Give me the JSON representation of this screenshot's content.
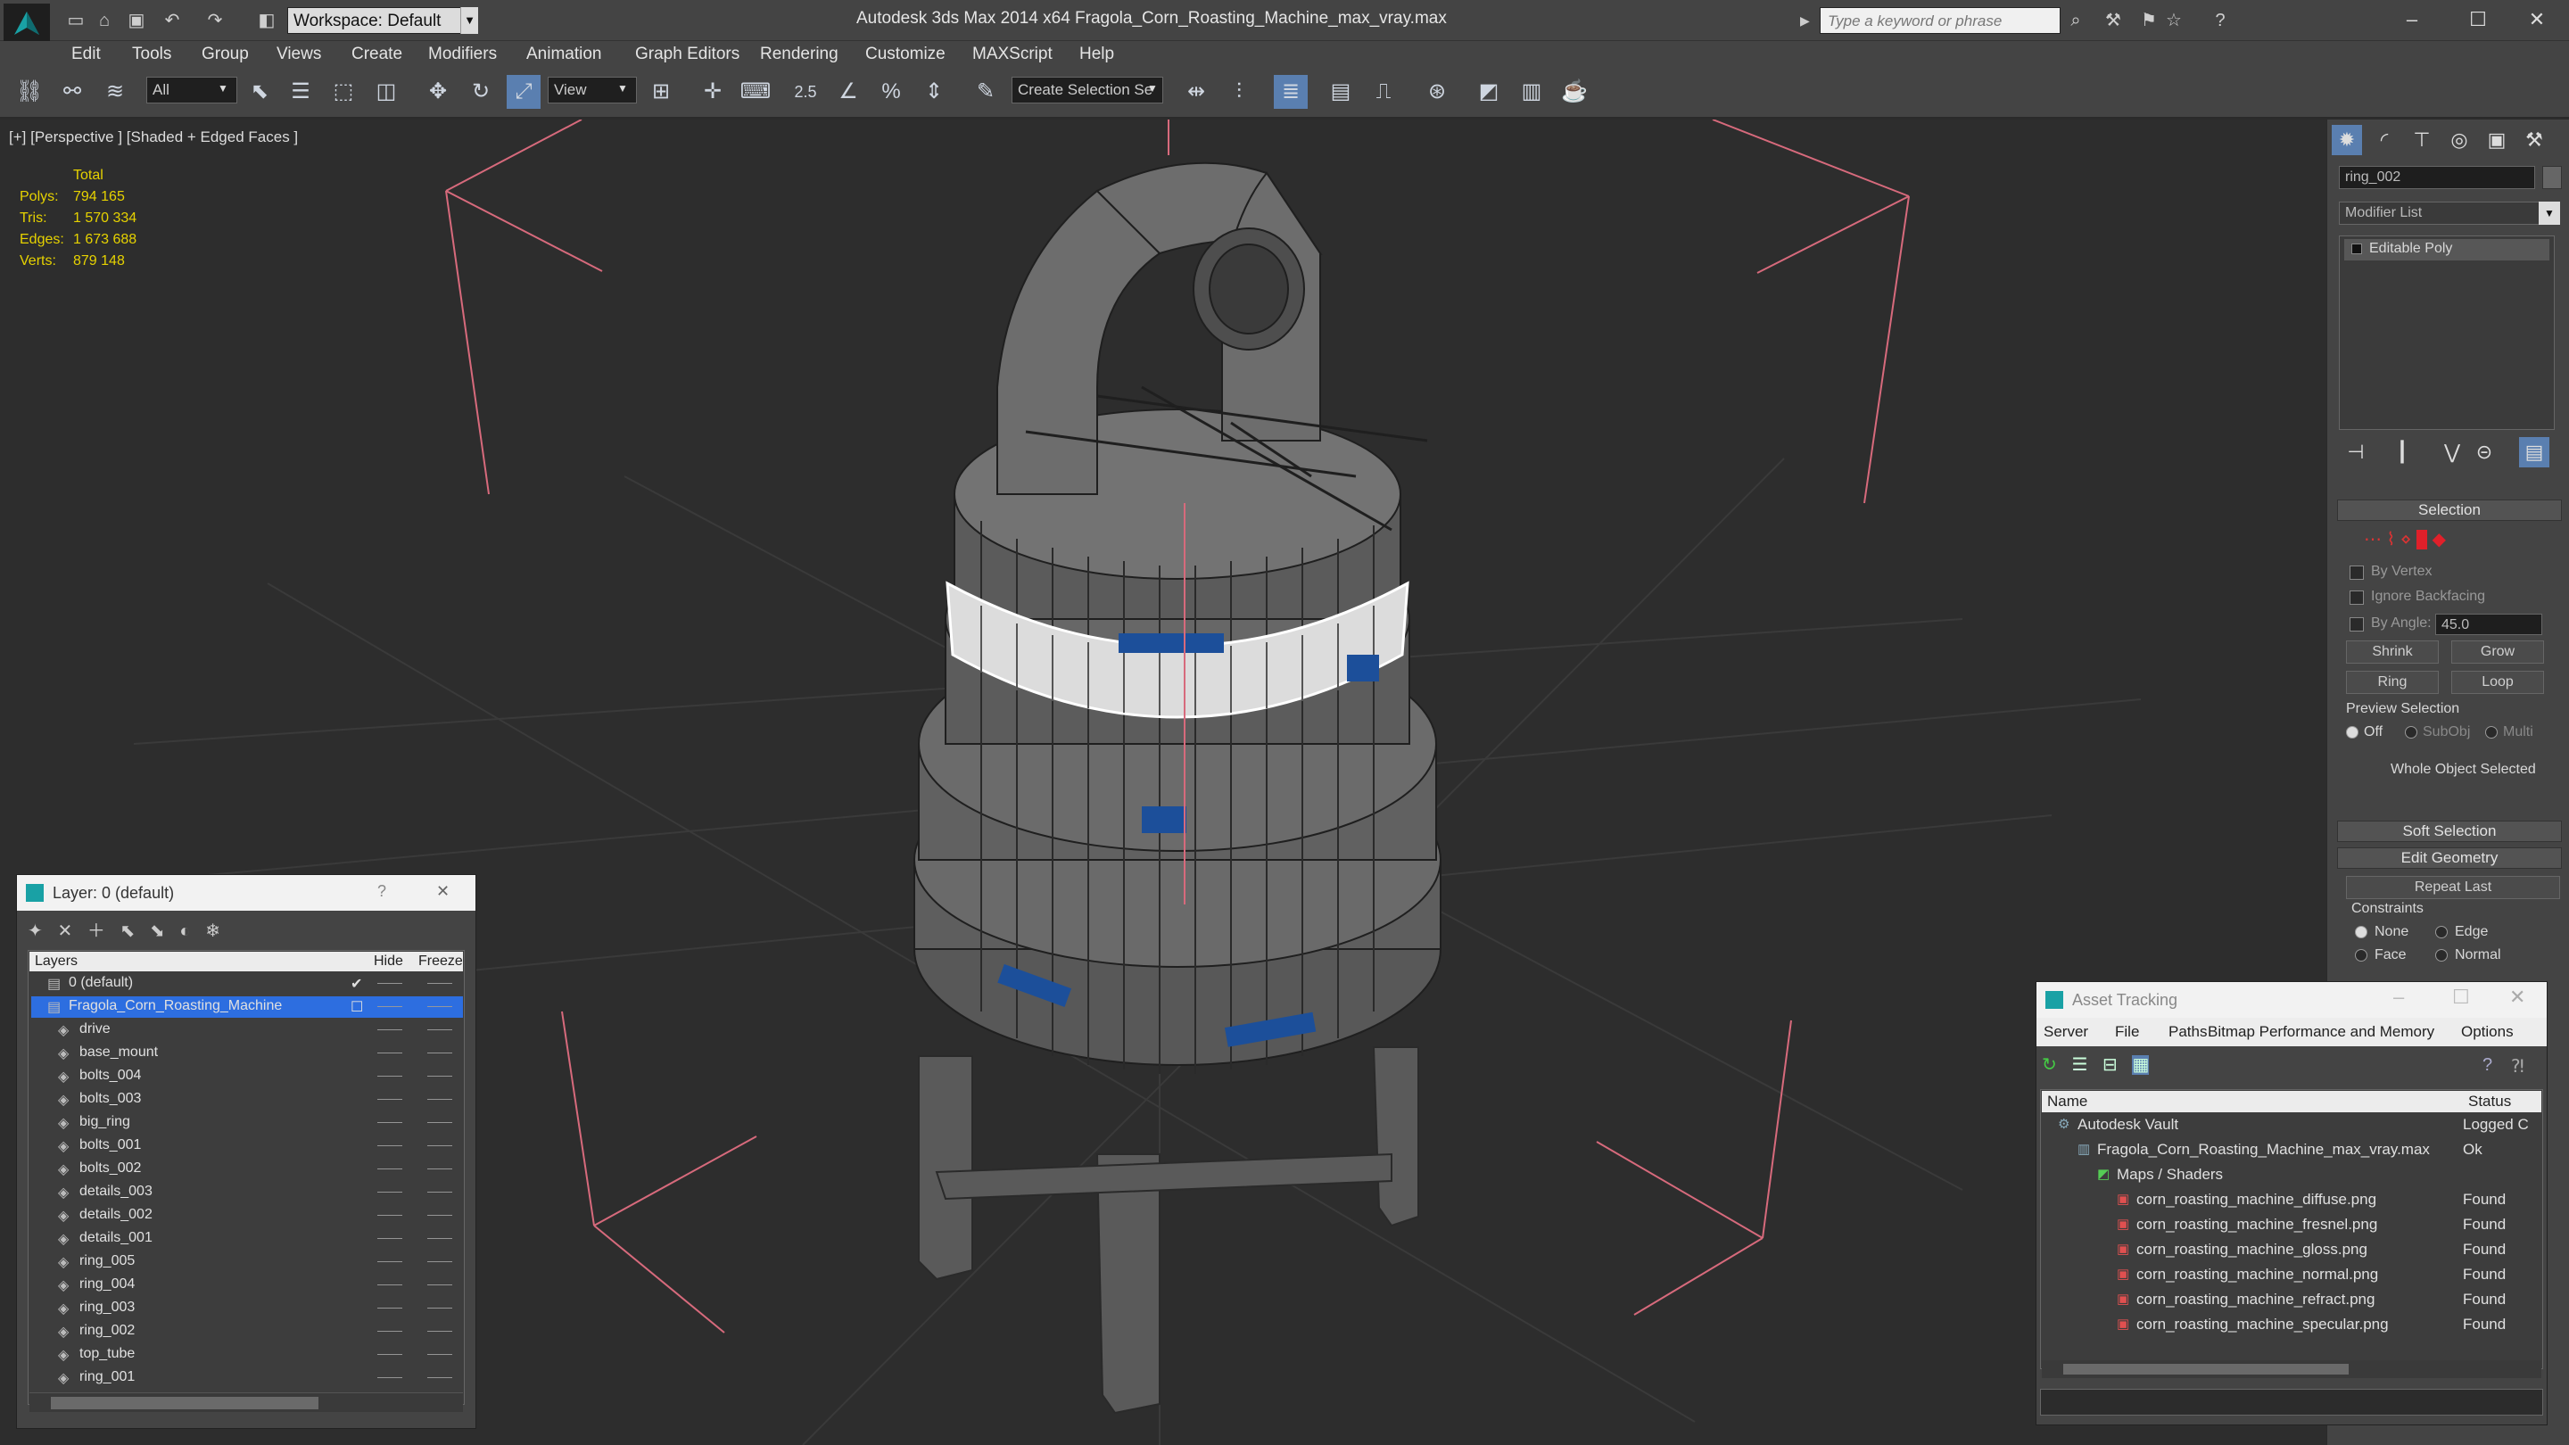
{
  "titlebar": {
    "workspace": "Workspace: Default",
    "title": "Autodesk 3ds Max  2014 x64        Fragola_Corn_Roasting_Machine_max_vray.max",
    "search_placeholder": "Type a keyword or phrase"
  },
  "menu": [
    "Edit",
    "Tools",
    "Group",
    "Views",
    "Create",
    "Modifiers",
    "Animation",
    "Graph Editors",
    "Rendering",
    "Customize",
    "MAXScript",
    "Help"
  ],
  "toolbar": {
    "filter": "All",
    "ref_coord": "View",
    "selection_set": "Create Selection Se",
    "snap_label": "2.5"
  },
  "viewport": {
    "label": "[+] [Perspective ] [Shaded + Edged Faces ]",
    "stats": {
      "header": "Total",
      "rows": [
        {
          "k": "Polys:",
          "v": "794 165"
        },
        {
          "k": "Tris:",
          "v": "1 570 334"
        },
        {
          "k": "Edges:",
          "v": "1 673 688"
        },
        {
          "k": "Verts:",
          "v": "879 148"
        }
      ]
    }
  },
  "command_panel": {
    "object_name": "ring_002",
    "modifier_list": "Modifier List",
    "stack_item": "Editable Poly",
    "selection": {
      "title": "Selection",
      "by_vertex": "By Vertex",
      "ignore_backfacing": "Ignore Backfacing",
      "by_angle": "By Angle:",
      "angle_value": "45.0",
      "shrink": "Shrink",
      "grow": "Grow",
      "ring": "Ring",
      "loop": "Loop",
      "preview_selection": "Preview Selection",
      "off": "Off",
      "subobj": "SubObj",
      "multi": "Multi",
      "status": "Whole Object Selected"
    },
    "soft_selection": "Soft Selection",
    "edit_geometry": "Edit Geometry",
    "repeat_last": "Repeat Last",
    "constraints": "Constraints",
    "none": "None",
    "edge": "Edge",
    "face": "Face",
    "normal": "Normal"
  },
  "layer_dialog": {
    "title": "Layer: 0 (default)",
    "help": "?",
    "close": "✕",
    "col_layers": "Layers",
    "col_hide": "Hide",
    "col_freeze": "Freeze",
    "rows": [
      "0 (default)",
      "Fragola_Corn_Roasting_Machine",
      "drive",
      "base_mount",
      "bolts_004",
      "bolts_003",
      "big_ring",
      "bolts_001",
      "bolts_002",
      "details_003",
      "details_002",
      "details_001",
      "ring_005",
      "ring_004",
      "ring_003",
      "ring_002",
      "top_tube",
      "ring_001",
      "Fragola_Corn_Roasting_Machine"
    ]
  },
  "asset_dialog": {
    "title": "Asset Tracking",
    "menu": [
      "Server",
      "File",
      "Paths",
      "Bitmap Performance and Memory",
      "Options"
    ],
    "col_name": "Name",
    "col_status": "Status",
    "rows": [
      {
        "name": "Autodesk Vault",
        "status": "Logged C",
        "icon": "vault-icon",
        "indent": 0
      },
      {
        "name": "Fragola_Corn_Roasting_Machine_max_vray.max",
        "status": "Ok",
        "icon": "max-file-icon",
        "indent": 1
      },
      {
        "name": "Maps / Shaders",
        "status": "",
        "icon": "maps-icon",
        "indent": 2
      },
      {
        "name": "corn_roasting_machine_diffuse.png",
        "status": "Found",
        "icon": "png-icon",
        "indent": 3
      },
      {
        "name": "corn_roasting_machine_fresnel.png",
        "status": "Found",
        "icon": "png-icon",
        "indent": 3
      },
      {
        "name": "corn_roasting_machine_gloss.png",
        "status": "Found",
        "icon": "png-icon",
        "indent": 3
      },
      {
        "name": "corn_roasting_machine_normal.png",
        "status": "Found",
        "icon": "png-icon",
        "indent": 3
      },
      {
        "name": "corn_roasting_machine_refract.png",
        "status": "Found",
        "icon": "png-icon",
        "indent": 3
      },
      {
        "name": "corn_roasting_machine_specular.png",
        "status": "Found",
        "icon": "png-icon",
        "indent": 3
      }
    ]
  },
  "colors": {
    "accent": "#1e6fd9",
    "stats": "#e6d200",
    "selection_red": "#e0202a"
  }
}
